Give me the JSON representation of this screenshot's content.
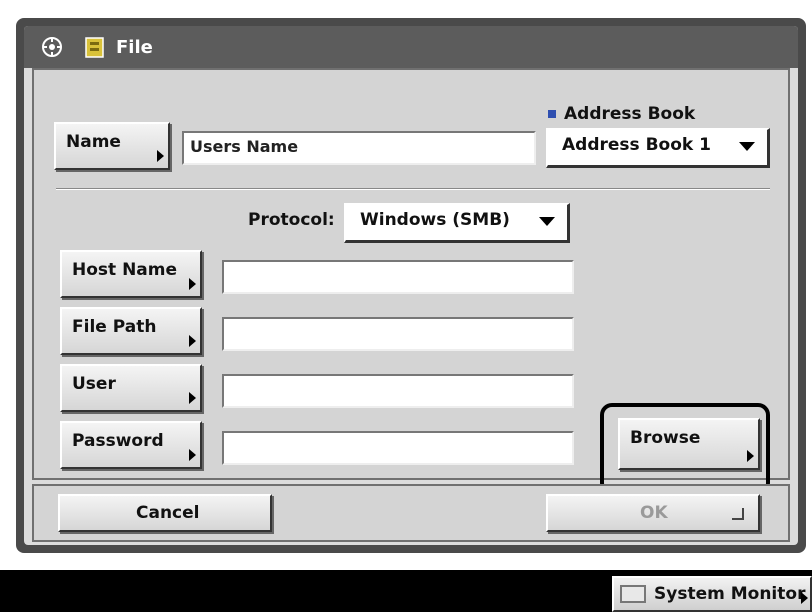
{
  "window": {
    "title": "File"
  },
  "name_row": {
    "name_button": "Name",
    "name_value": "Users Name",
    "address_book_label": "Address Book",
    "address_book_selected": "Address Book 1"
  },
  "protocol": {
    "label": "Protocol:",
    "selected": "Windows (SMB)"
  },
  "fields": [
    {
      "label": "Host Name",
      "value": ""
    },
    {
      "label": "File Path",
      "value": ""
    },
    {
      "label": "User",
      "value": ""
    },
    {
      "label": "Password",
      "value": ""
    }
  ],
  "browse_button": "Browse",
  "footer": {
    "cancel": "Cancel",
    "ok": "OK"
  },
  "system_monitor": "System Monitor",
  "colors": {
    "title_bar": "#5c5c5c",
    "frame": "#4a4a4a",
    "panel": "#d4d4d4",
    "accent_blue": "#2f4fb0"
  },
  "icons": [
    "settings-icon",
    "file-folder-icon",
    "system-monitor-icon"
  ]
}
